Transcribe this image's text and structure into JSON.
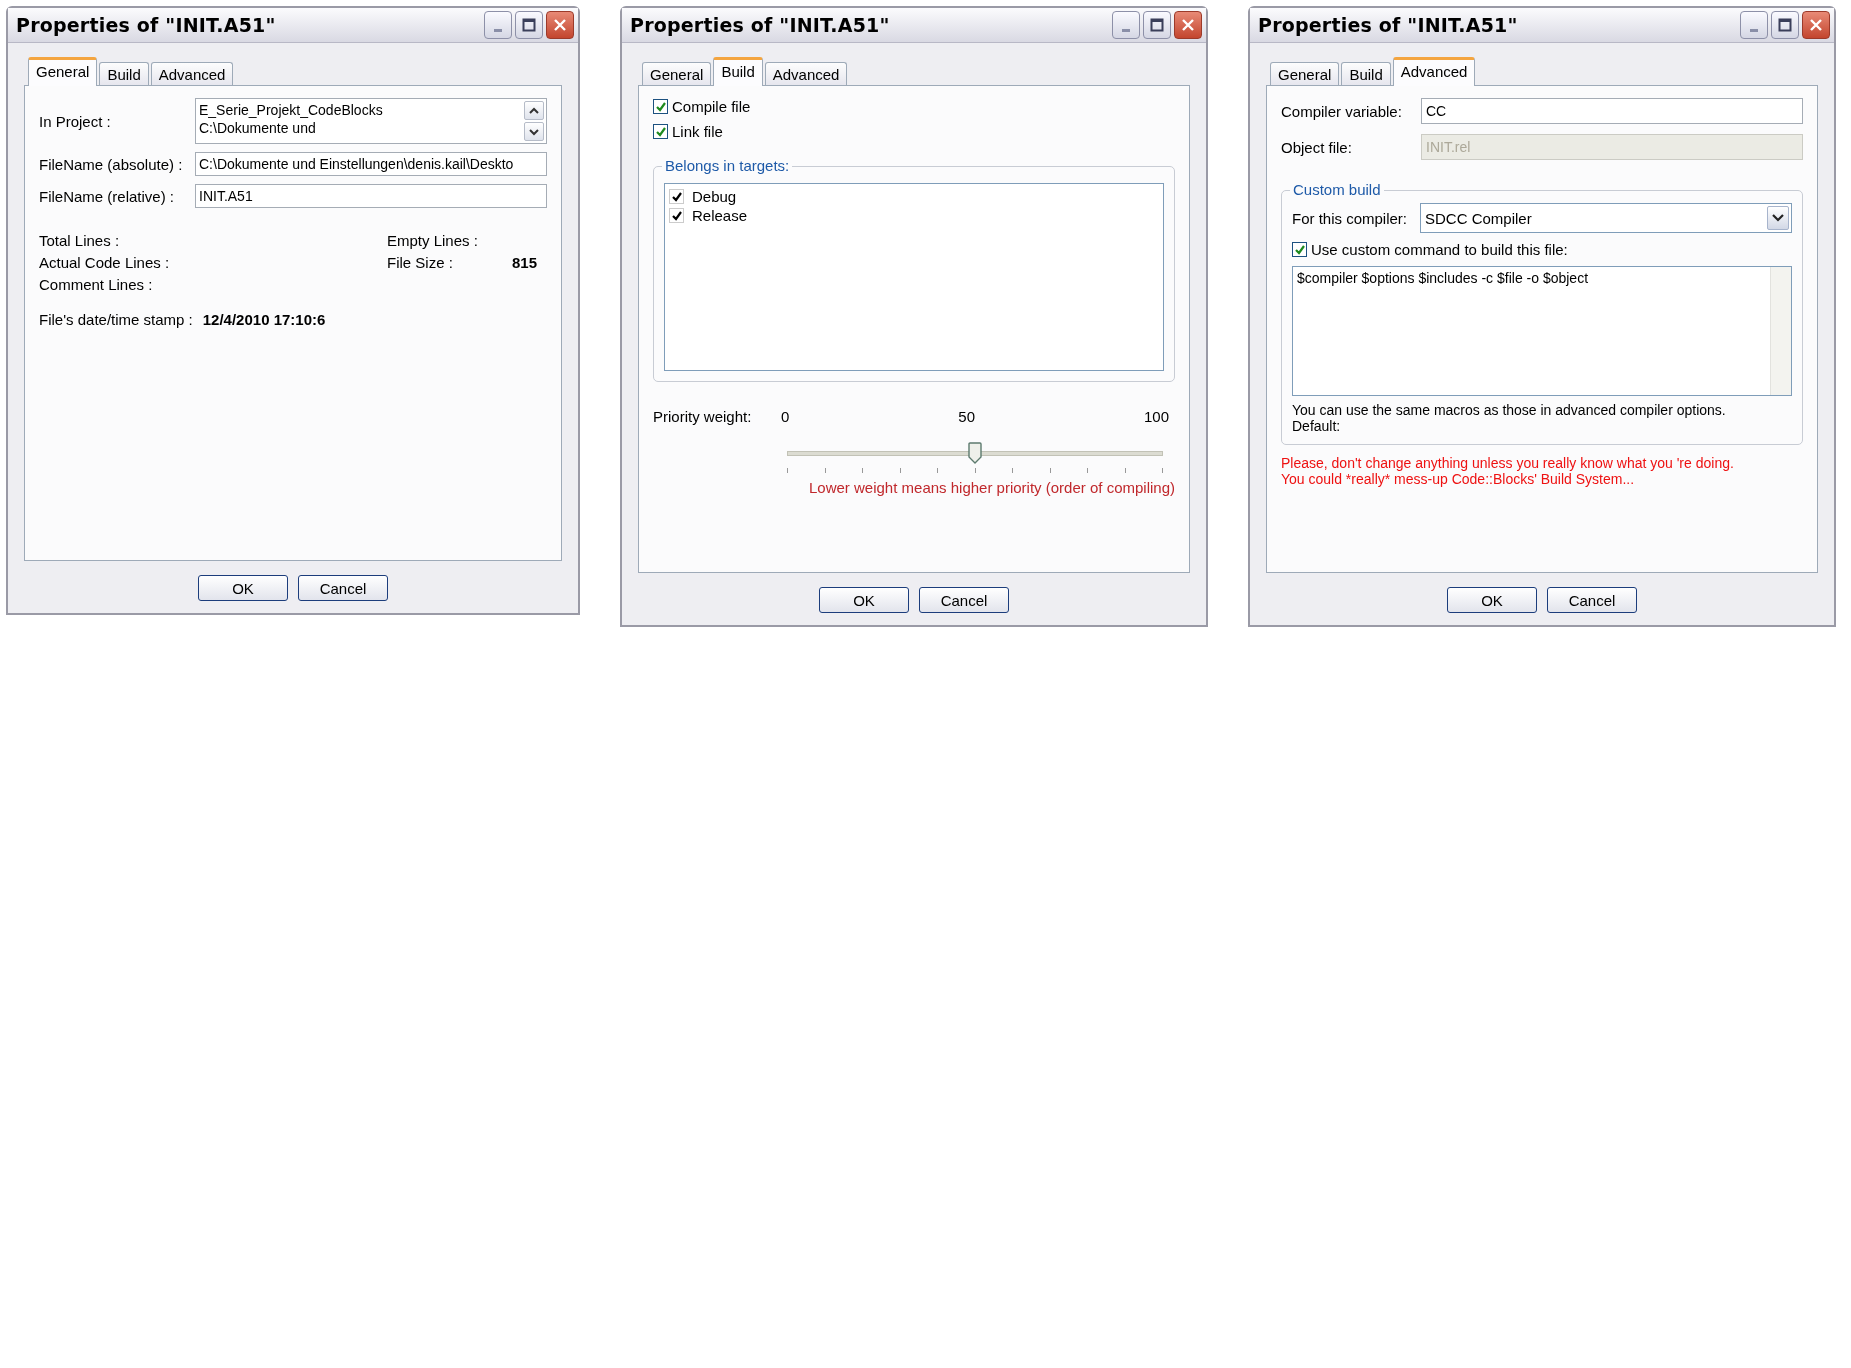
{
  "dialogs": [
    {
      "kind": "general",
      "title": "Properties of \"INIT.A51\"",
      "tabs": [
        {
          "label": "General",
          "selected": true
        },
        {
          "label": "Build",
          "selected": false
        },
        {
          "label": "Advanced",
          "selected": false
        }
      ],
      "in_project": {
        "label": "In Project :",
        "lines": [
          "E_Serie_Projekt_CodeBlocks",
          "C:\\Dokumente und"
        ]
      },
      "filename_absolute": {
        "label": "FileName (absolute) :",
        "value": "C:\\Dokumente und Einstellungen\\denis.kail\\Deskto"
      },
      "filename_relative": {
        "label": "FileName (relative) :",
        "value": "INIT.A51"
      },
      "stats_left": [
        {
          "label": "Total Lines :"
        },
        {
          "label": "Actual Code Lines :"
        },
        {
          "label": "Comment Lines :"
        }
      ],
      "stats_right": [
        {
          "label": "Empty Lines :"
        },
        {
          "label": "File Size :",
          "value": "815"
        }
      ],
      "timestamp": {
        "label": "File's date/time stamp :",
        "value": "12/4/2010 17:10:6"
      },
      "buttons": [
        "OK",
        "Cancel"
      ]
    },
    {
      "kind": "build",
      "title": "Properties of \"INIT.A51\"",
      "tabs": [
        {
          "label": "General",
          "selected": false
        },
        {
          "label": "Build",
          "selected": true
        },
        {
          "label": "Advanced",
          "selected": false
        }
      ],
      "options": [
        {
          "label": "Compile file",
          "checked": true
        },
        {
          "label": "Link file",
          "checked": true
        }
      ],
      "targets": {
        "legend": "Belongs in targets:",
        "items": [
          {
            "label": "Debug",
            "checked": true
          },
          {
            "label": "Release",
            "checked": true
          }
        ]
      },
      "priority": {
        "label": "Priority weight:",
        "scale": [
          "0",
          "50",
          "100"
        ],
        "level": 0.5,
        "note": "Lower weight means higher priority (order of compiling)"
      },
      "buttons": [
        "OK",
        "Cancel"
      ]
    },
    {
      "kind": "advanced",
      "title": "Properties of \"INIT.A51\"",
      "tabs": [
        {
          "label": "General",
          "selected": false
        },
        {
          "label": "Build",
          "selected": false
        },
        {
          "label": "Advanced",
          "selected": true
        }
      ],
      "compiler_variable": {
        "label": "Compiler variable:",
        "value": "CC"
      },
      "object_file": {
        "label": "Object file:",
        "value": "INIT.rel",
        "disabled": true
      },
      "custom_build": {
        "legend": "Custom build",
        "compiler": {
          "label": "For this compiler:",
          "value": "SDCC Compiler"
        },
        "use_custom": {
          "label": "Use custom command to build this file:",
          "checked": true
        },
        "command": "$compiler $options $includes -c $file -o $object",
        "hint": [
          "You can use the same macros as those in advanced compiler options.",
          "Default:"
        ]
      },
      "warning": [
        "Please, don't change anything unless you really know what you 're doing.",
        "You could *really* mess-up Code::Blocks' Build System..."
      ],
      "buttons": [
        "OK",
        "Cancel"
      ]
    }
  ]
}
